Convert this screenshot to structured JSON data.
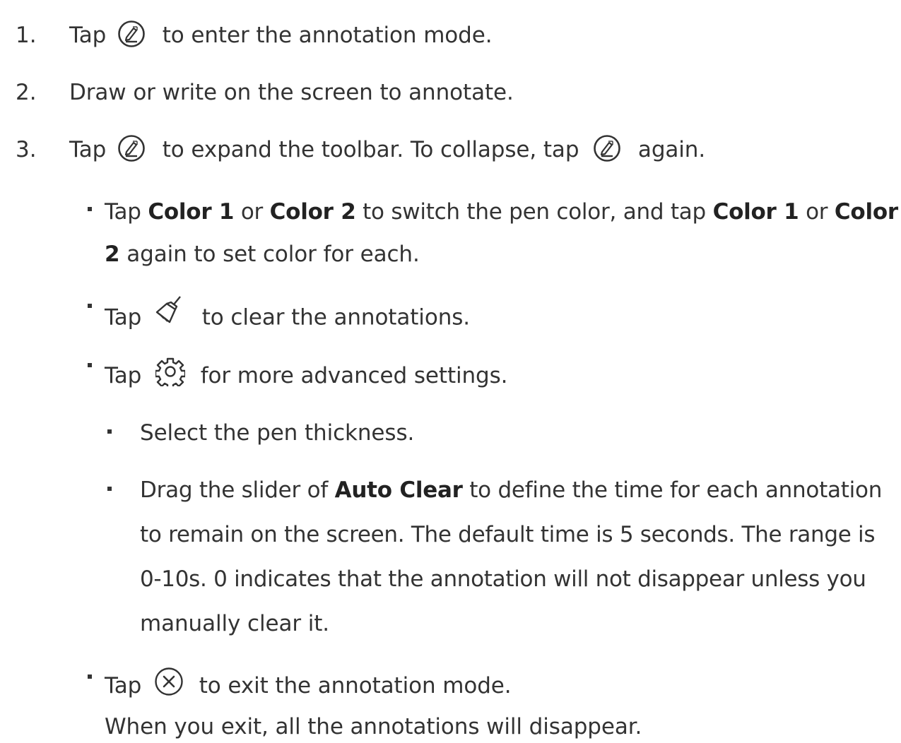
{
  "steps": [
    {
      "number": "1.",
      "text_a": "Tap",
      "icon": "pen-circle-icon",
      "text_b": "to enter the annotation mode."
    },
    {
      "number": "2.",
      "text_a": "Draw or write on the screen to annotate."
    },
    {
      "number": "3.",
      "text_a": "Tap",
      "icon": "pen-circle-icon",
      "text_b": "to expand the toolbar. To collapse, tap",
      "icon2": "pen-circle-icon",
      "text_c": "again."
    }
  ],
  "color_bullet": {
    "t1": "Tap",
    "b1": "Color 1",
    "t2": "or",
    "b2": "Color 2",
    "t3": "to switch the pen color, and tap",
    "b3": "Color 1",
    "t4": "or",
    "b4a": "Color",
    "b4b": "2",
    "t5": "again to set color for each."
  },
  "clear_bullet": {
    "t1": "Tap",
    "icon": "broom-icon",
    "t2": "to clear the annotations."
  },
  "settings_bullet": {
    "t1": "Tap",
    "icon": "gear-icon",
    "t2": "for more advanced settings."
  },
  "sub_bullets": {
    "thickness": "Select the pen thickness.",
    "auto_clear": {
      "t1": "Drag the slider of",
      "bold": "Auto Clear",
      "t2": "to define the time for each annotation",
      "line2": "to remain on the screen. The default time is 5 seconds. The range is",
      "line3": "0-10s. 0 indicates that the annotation will not disappear unless you",
      "line4": "manually clear it."
    }
  },
  "exit_bullet": {
    "t1": "Tap",
    "icon": "close-circle-icon",
    "t2": "to exit the annotation mode.",
    "note": "When you exit, all the annotations will disappear."
  }
}
